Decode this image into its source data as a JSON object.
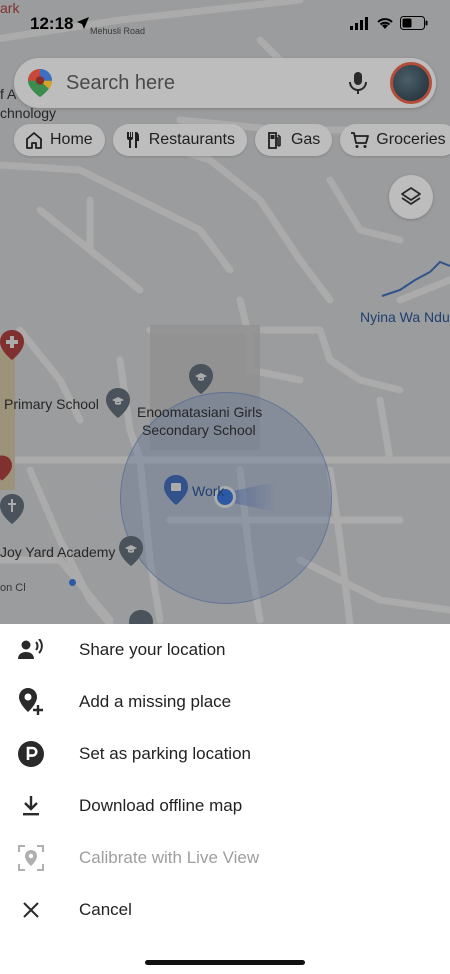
{
  "status_bar": {
    "time": "12:18"
  },
  "search": {
    "placeholder": "Search here"
  },
  "chips": [
    {
      "label": "Home",
      "icon": "home-icon"
    },
    {
      "label": "Restaurants",
      "icon": "restaurant-icon"
    },
    {
      "label": "Gas",
      "icon": "gas-icon"
    },
    {
      "label": "Groceries",
      "icon": "cart-icon"
    }
  ],
  "map": {
    "labels": {
      "road": "Mehusli Road",
      "top_left_1": "ark",
      "top_left_2": "f A",
      "top_left_3": "chnology",
      "river": "Nyina Wa Ndu",
      "primary_school": "Primary School",
      "secondary_school_1": "Enoomatasiani Girls",
      "secondary_school_2": "Secondary School",
      "work": "Work",
      "joy_yard": "Joy Yard Academy",
      "street": "on Cl"
    }
  },
  "sheet": {
    "items": [
      {
        "label": "Share your location",
        "icon": "share-location-icon",
        "enabled": true
      },
      {
        "label": "Add a missing place",
        "icon": "add-place-icon",
        "enabled": true
      },
      {
        "label": "Set as parking location",
        "icon": "parking-icon",
        "enabled": true
      },
      {
        "label": "Download offline map",
        "icon": "download-icon",
        "enabled": true
      },
      {
        "label": "Calibrate with Live View",
        "icon": "live-view-icon",
        "enabled": false
      },
      {
        "label": "Cancel",
        "icon": "close-icon",
        "enabled": true
      }
    ]
  },
  "colors": {
    "location_dot": "#4285f4",
    "accuracy_circle": "#a9c1ec",
    "disabled_text": "#9e9e9e",
    "river": "#4a7bd0"
  }
}
